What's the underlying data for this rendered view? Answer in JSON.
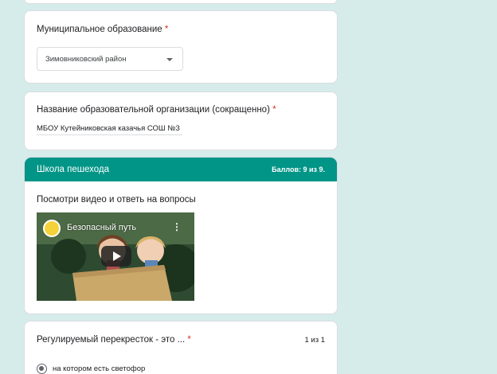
{
  "municipality": {
    "label": "Муниципальное образование",
    "required_mark": "*",
    "selected_value": "Зимовниковский район"
  },
  "organization": {
    "label": "Название образовательной организации (сокращенно)",
    "required_mark": "*",
    "answer": "МБОУ Кутейниковская казачья СОШ №3"
  },
  "section": {
    "title": "Школа пешехода",
    "score": "Баллов: 9 из 9.",
    "instruction": "Посмотри видео и ответь на вопросы",
    "video": {
      "title": "Безопасный путь",
      "icons": [
        "channel-logo",
        "more-vert-icon",
        "play-icon"
      ]
    }
  },
  "question": {
    "label": "Регулируемый перекресток - это ...",
    "required_mark": "*",
    "points": "1 из 1",
    "selected_option": "на котором есть светофор"
  },
  "colors": {
    "background": "#d6ecea",
    "accent": "#009587",
    "required": "#d93025"
  }
}
